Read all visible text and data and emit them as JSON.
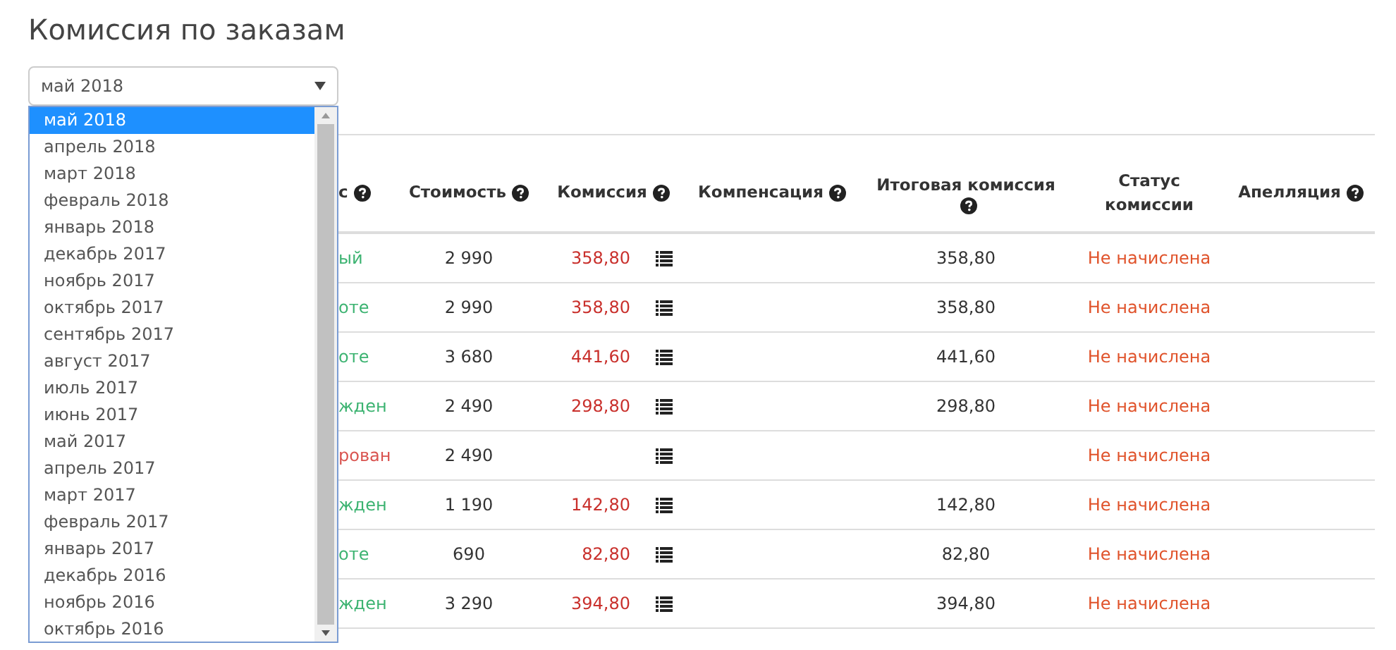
{
  "title": "Комиссия по заказам",
  "month_select": {
    "value": "май 2018"
  },
  "month_dropdown": {
    "items": [
      {
        "label": "май 2018",
        "selected": true
      },
      {
        "label": "апрель 2018",
        "selected": false
      },
      {
        "label": "март 2018",
        "selected": false
      },
      {
        "label": "февраль 2018",
        "selected": false
      },
      {
        "label": "январь 2018",
        "selected": false
      },
      {
        "label": "декабрь 2017",
        "selected": false
      },
      {
        "label": "ноябрь 2017",
        "selected": false
      },
      {
        "label": "октябрь 2017",
        "selected": false
      },
      {
        "label": "сентябрь 2017",
        "selected": false
      },
      {
        "label": "август 2017",
        "selected": false
      },
      {
        "label": "июль 2017",
        "selected": false
      },
      {
        "label": "июнь 2017",
        "selected": false
      },
      {
        "label": "май 2017",
        "selected": false
      },
      {
        "label": "апрель 2017",
        "selected": false
      },
      {
        "label": "март 2017",
        "selected": false
      },
      {
        "label": "февраль 2017",
        "selected": false
      },
      {
        "label": "январь 2017",
        "selected": false
      },
      {
        "label": "декабрь 2016",
        "selected": false
      },
      {
        "label": "ноябрь 2016",
        "selected": false
      },
      {
        "label": "октябрь 2016",
        "selected": false
      }
    ]
  },
  "table": {
    "columns": [
      {
        "label": "с",
        "help": true
      },
      {
        "label": "Стоимость",
        "help": true
      },
      {
        "label": "Комиссия",
        "help": true
      },
      {
        "label": "Компенсация",
        "help": true
      },
      {
        "label": "Итоговая комиссия",
        "help": true
      },
      {
        "label": "Статус комиссии",
        "help": false
      },
      {
        "label": "Апелляция",
        "help": true
      }
    ],
    "rows": [
      {
        "status": "ый",
        "color": "#3cb371",
        "cost": "2 990",
        "commission": "358,80",
        "final": "358,80",
        "commission_status": "Не начислена"
      },
      {
        "status": "оте",
        "color": "#3cb371",
        "cost": "2 990",
        "commission": "358,80",
        "final": "358,80",
        "commission_status": "Не начислена"
      },
      {
        "status": "оте",
        "color": "#3cb371",
        "cost": "3 680",
        "commission": "441,60",
        "final": "441,60",
        "commission_status": "Не начислена"
      },
      {
        "status": "жден",
        "color": "#3cb371",
        "cost": "2 490",
        "commission": "298,80",
        "final": "298,80",
        "commission_status": "Не начислена"
      },
      {
        "status": "рован",
        "color": "#d9534f",
        "cost": "2 490",
        "commission_status": "Не начислена"
      },
      {
        "status": "жден",
        "color": "#3cb371",
        "cost": "1 190",
        "commission": "142,80",
        "final": "142,80",
        "commission_status": "Не начислена"
      },
      {
        "status": "оте",
        "color": "#3cb371",
        "cost": "690",
        "commission": "82,80",
        "final": "82,80",
        "commission_status": "Не начислена"
      },
      {
        "status": "жден",
        "color": "#3cb371",
        "cost": "3 290",
        "commission": "394,80",
        "final": "394,80",
        "commission_status": "Не начислена"
      }
    ]
  }
}
